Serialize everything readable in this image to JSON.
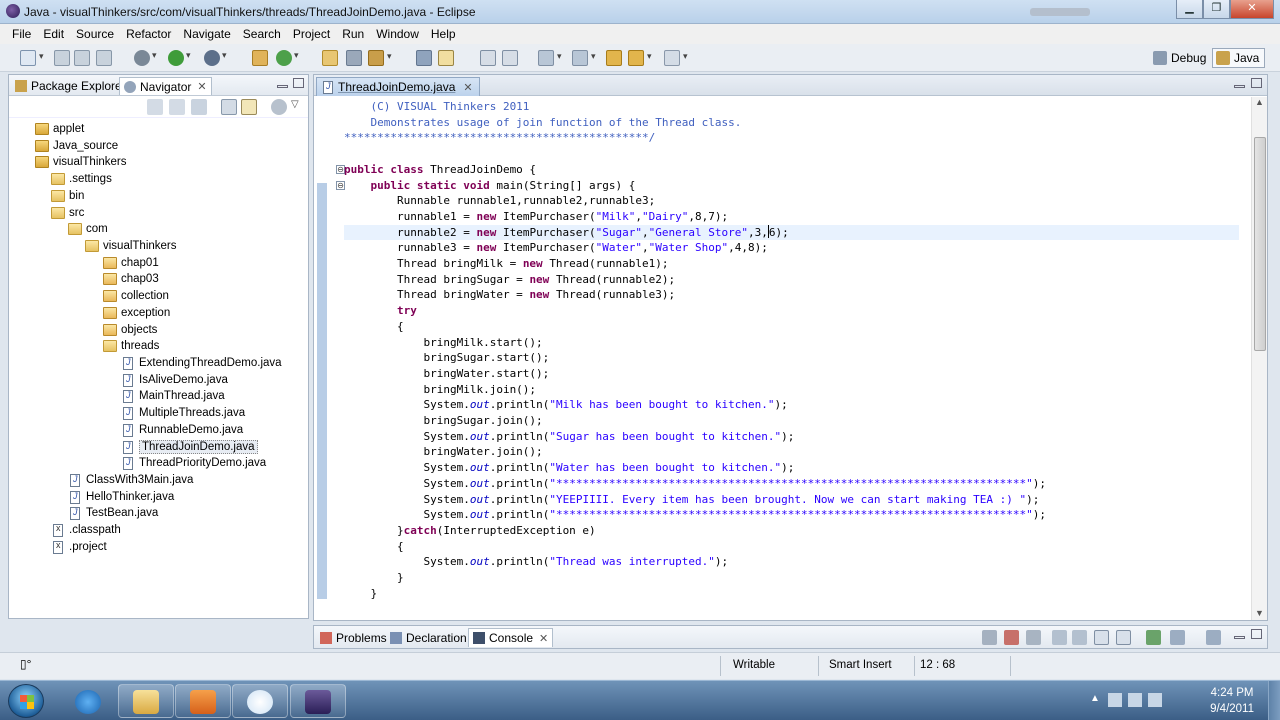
{
  "window": {
    "title": "Java - visualThinkers/src/com/visualThinkers/threads/ThreadJoinDemo.java - Eclipse"
  },
  "menu": [
    "File",
    "Edit",
    "Source",
    "Refactor",
    "Navigate",
    "Search",
    "Project",
    "Run",
    "Window",
    "Help"
  ],
  "perspectives": {
    "debug": "Debug",
    "java": "Java"
  },
  "left_panel": {
    "tabs": [
      {
        "label": "Package Explorer"
      },
      {
        "label": "Navigator"
      }
    ],
    "tree": [
      {
        "label": "applet",
        "type": "project",
        "depth": 0
      },
      {
        "label": "Java_source",
        "type": "project",
        "depth": 0
      },
      {
        "label": "visualThinkers",
        "type": "project",
        "depth": 0
      },
      {
        "label": ".settings",
        "type": "folder",
        "depth": 1
      },
      {
        "label": "bin",
        "type": "folder",
        "depth": 1
      },
      {
        "label": "src",
        "type": "folder",
        "depth": 1
      },
      {
        "label": "com",
        "type": "folder",
        "depth": 2
      },
      {
        "label": "visualThinkers",
        "type": "folder",
        "depth": 3
      },
      {
        "label": "chap01",
        "type": "pkg",
        "depth": 4
      },
      {
        "label": "chap03",
        "type": "pkg",
        "depth": 4
      },
      {
        "label": "collection",
        "type": "pkg",
        "depth": 4
      },
      {
        "label": "exception",
        "type": "pkg",
        "depth": 4
      },
      {
        "label": "objects",
        "type": "pkg",
        "depth": 4
      },
      {
        "label": "threads",
        "type": "folder",
        "depth": 4
      },
      {
        "label": "ExtendingThreadDemo.java",
        "type": "java",
        "depth": 5
      },
      {
        "label": "IsAliveDemo.java",
        "type": "java",
        "depth": 5
      },
      {
        "label": "MainThread.java",
        "type": "java",
        "depth": 5
      },
      {
        "label": "MultipleThreads.java",
        "type": "java",
        "depth": 5
      },
      {
        "label": "RunnableDemo.java",
        "type": "java",
        "depth": 5
      },
      {
        "label": "ThreadJoinDemo.java",
        "type": "java",
        "depth": 5,
        "selected": true
      },
      {
        "label": "ThreadPriorityDemo.java",
        "type": "java",
        "depth": 5
      },
      {
        "label": "ClassWith3Main.java",
        "type": "java",
        "depth": 2
      },
      {
        "label": "HelloThinker.java",
        "type": "java",
        "depth": 2
      },
      {
        "label": "TestBean.java",
        "type": "java",
        "depth": 2
      },
      {
        "label": ".classpath",
        "type": "xfile",
        "depth": 1
      },
      {
        "label": ".project",
        "type": "xfile",
        "depth": 1
      }
    ]
  },
  "editor": {
    "tab_label": "ThreadJoinDemo.java",
    "lines": [
      [
        [
          "    (C) VISUAL Thinkers 2011",
          "cm"
        ]
      ],
      [
        [
          "    Demonstrates usage of join function of the Thread class.",
          "cm"
        ]
      ],
      [
        [
          "**********************************************/",
          "cm"
        ]
      ],
      [
        [
          "",
          ""
        ]
      ],
      [
        [
          "public class ",
          "kw"
        ],
        [
          "ThreadJoinDemo {",
          ""
        ]
      ],
      [
        [
          "    ",
          ""
        ],
        [
          "public static void ",
          "kw"
        ],
        [
          "main(String[] args) {",
          ""
        ]
      ],
      [
        [
          "        Runnable runnable1,runnable2,runnable3;",
          ""
        ]
      ],
      [
        [
          "        runnable1 = ",
          ""
        ],
        [
          "new ",
          "kw"
        ],
        [
          "ItemPurchaser(",
          ""
        ],
        [
          "\"Milk\"",
          "str"
        ],
        [
          ",",
          ""
        ],
        [
          "\"Dairy\"",
          "str"
        ],
        [
          ",8,7);",
          ""
        ]
      ],
      [
        [
          "        runnable2 = ",
          ""
        ],
        [
          "new ",
          "kw"
        ],
        [
          "ItemPurchaser(",
          ""
        ],
        [
          "\"Sugar\"",
          "str"
        ],
        [
          ",",
          ""
        ],
        [
          "\"General Store\"",
          "str"
        ],
        [
          ",3,",
          ""
        ],
        [
          "CARET",
          "caret"
        ],
        [
          "6);",
          ""
        ]
      ],
      [
        [
          "        runnable3 = ",
          ""
        ],
        [
          "new ",
          "kw"
        ],
        [
          "ItemPurchaser(",
          ""
        ],
        [
          "\"Water\"",
          "str"
        ],
        [
          ",",
          ""
        ],
        [
          "\"Water Shop\"",
          "str"
        ],
        [
          ",4,8);",
          ""
        ]
      ],
      [
        [
          "        Thread bringMilk = ",
          ""
        ],
        [
          "new ",
          "kw"
        ],
        [
          "Thread(runnable1);",
          ""
        ]
      ],
      [
        [
          "        Thread bringSugar = ",
          ""
        ],
        [
          "new ",
          "kw"
        ],
        [
          "Thread(runnable2);",
          ""
        ]
      ],
      [
        [
          "        Thread bringWater = ",
          ""
        ],
        [
          "new ",
          "kw"
        ],
        [
          "Thread(runnable3);",
          ""
        ]
      ],
      [
        [
          "        ",
          ""
        ],
        [
          "try",
          "kw"
        ]
      ],
      [
        [
          "        {",
          ""
        ]
      ],
      [
        [
          "            bringMilk.start();",
          ""
        ]
      ],
      [
        [
          "            bringSugar.start();",
          ""
        ]
      ],
      [
        [
          "            bringWater.start();",
          ""
        ]
      ],
      [
        [
          "            bringMilk.join();",
          ""
        ]
      ],
      [
        [
          "            System.",
          ""
        ],
        [
          "out",
          "fld"
        ],
        [
          ".println(",
          ""
        ],
        [
          "\"Milk has been bought to kitchen.\"",
          "str"
        ],
        [
          ");",
          ""
        ]
      ],
      [
        [
          "            bringSugar.join();",
          ""
        ]
      ],
      [
        [
          "            System.",
          ""
        ],
        [
          "out",
          "fld"
        ],
        [
          ".println(",
          ""
        ],
        [
          "\"Sugar has been bought to kitchen.\"",
          "str"
        ],
        [
          ");",
          ""
        ]
      ],
      [
        [
          "            bringWater.join();",
          ""
        ]
      ],
      [
        [
          "            System.",
          ""
        ],
        [
          "out",
          "fld"
        ],
        [
          ".println(",
          ""
        ],
        [
          "\"Water has been bought to kitchen.\"",
          "str"
        ],
        [
          ");",
          ""
        ]
      ],
      [
        [
          "            System.",
          ""
        ],
        [
          "out",
          "fld"
        ],
        [
          ".println(",
          ""
        ],
        [
          "\"***********************************************************************\"",
          "str"
        ],
        [
          ");",
          ""
        ]
      ],
      [
        [
          "            System.",
          ""
        ],
        [
          "out",
          "fld"
        ],
        [
          ".println(",
          ""
        ],
        [
          "\"YEEPIIII. Every item has been brought. Now we can start making TEA :) \"",
          "str"
        ],
        [
          ");",
          ""
        ]
      ],
      [
        [
          "            System.",
          ""
        ],
        [
          "out",
          "fld"
        ],
        [
          ".println(",
          ""
        ],
        [
          "\"***********************************************************************\"",
          "str"
        ],
        [
          ");",
          ""
        ]
      ],
      [
        [
          "        }",
          ""
        ],
        [
          "catch",
          "kw"
        ],
        [
          "(InterruptedException e)",
          ""
        ]
      ],
      [
        [
          "        {",
          ""
        ]
      ],
      [
        [
          "            System.",
          ""
        ],
        [
          "out",
          "fld"
        ],
        [
          ".println(",
          ""
        ],
        [
          "\"Thread was interrupted.\"",
          "str"
        ],
        [
          ");",
          ""
        ]
      ],
      [
        [
          "        }",
          ""
        ]
      ],
      [
        [
          "    }",
          ""
        ]
      ]
    ],
    "current_line_index": 8
  },
  "bottom_panel": {
    "tabs": [
      {
        "label": "Problems"
      },
      {
        "label": "Declaration"
      },
      {
        "label": "Console"
      }
    ]
  },
  "status": {
    "writable": "Writable",
    "insert_mode": "Smart Insert",
    "position": "12 : 68"
  },
  "taskbar": {
    "time": "4:24 PM",
    "date": "9/4/2011"
  }
}
